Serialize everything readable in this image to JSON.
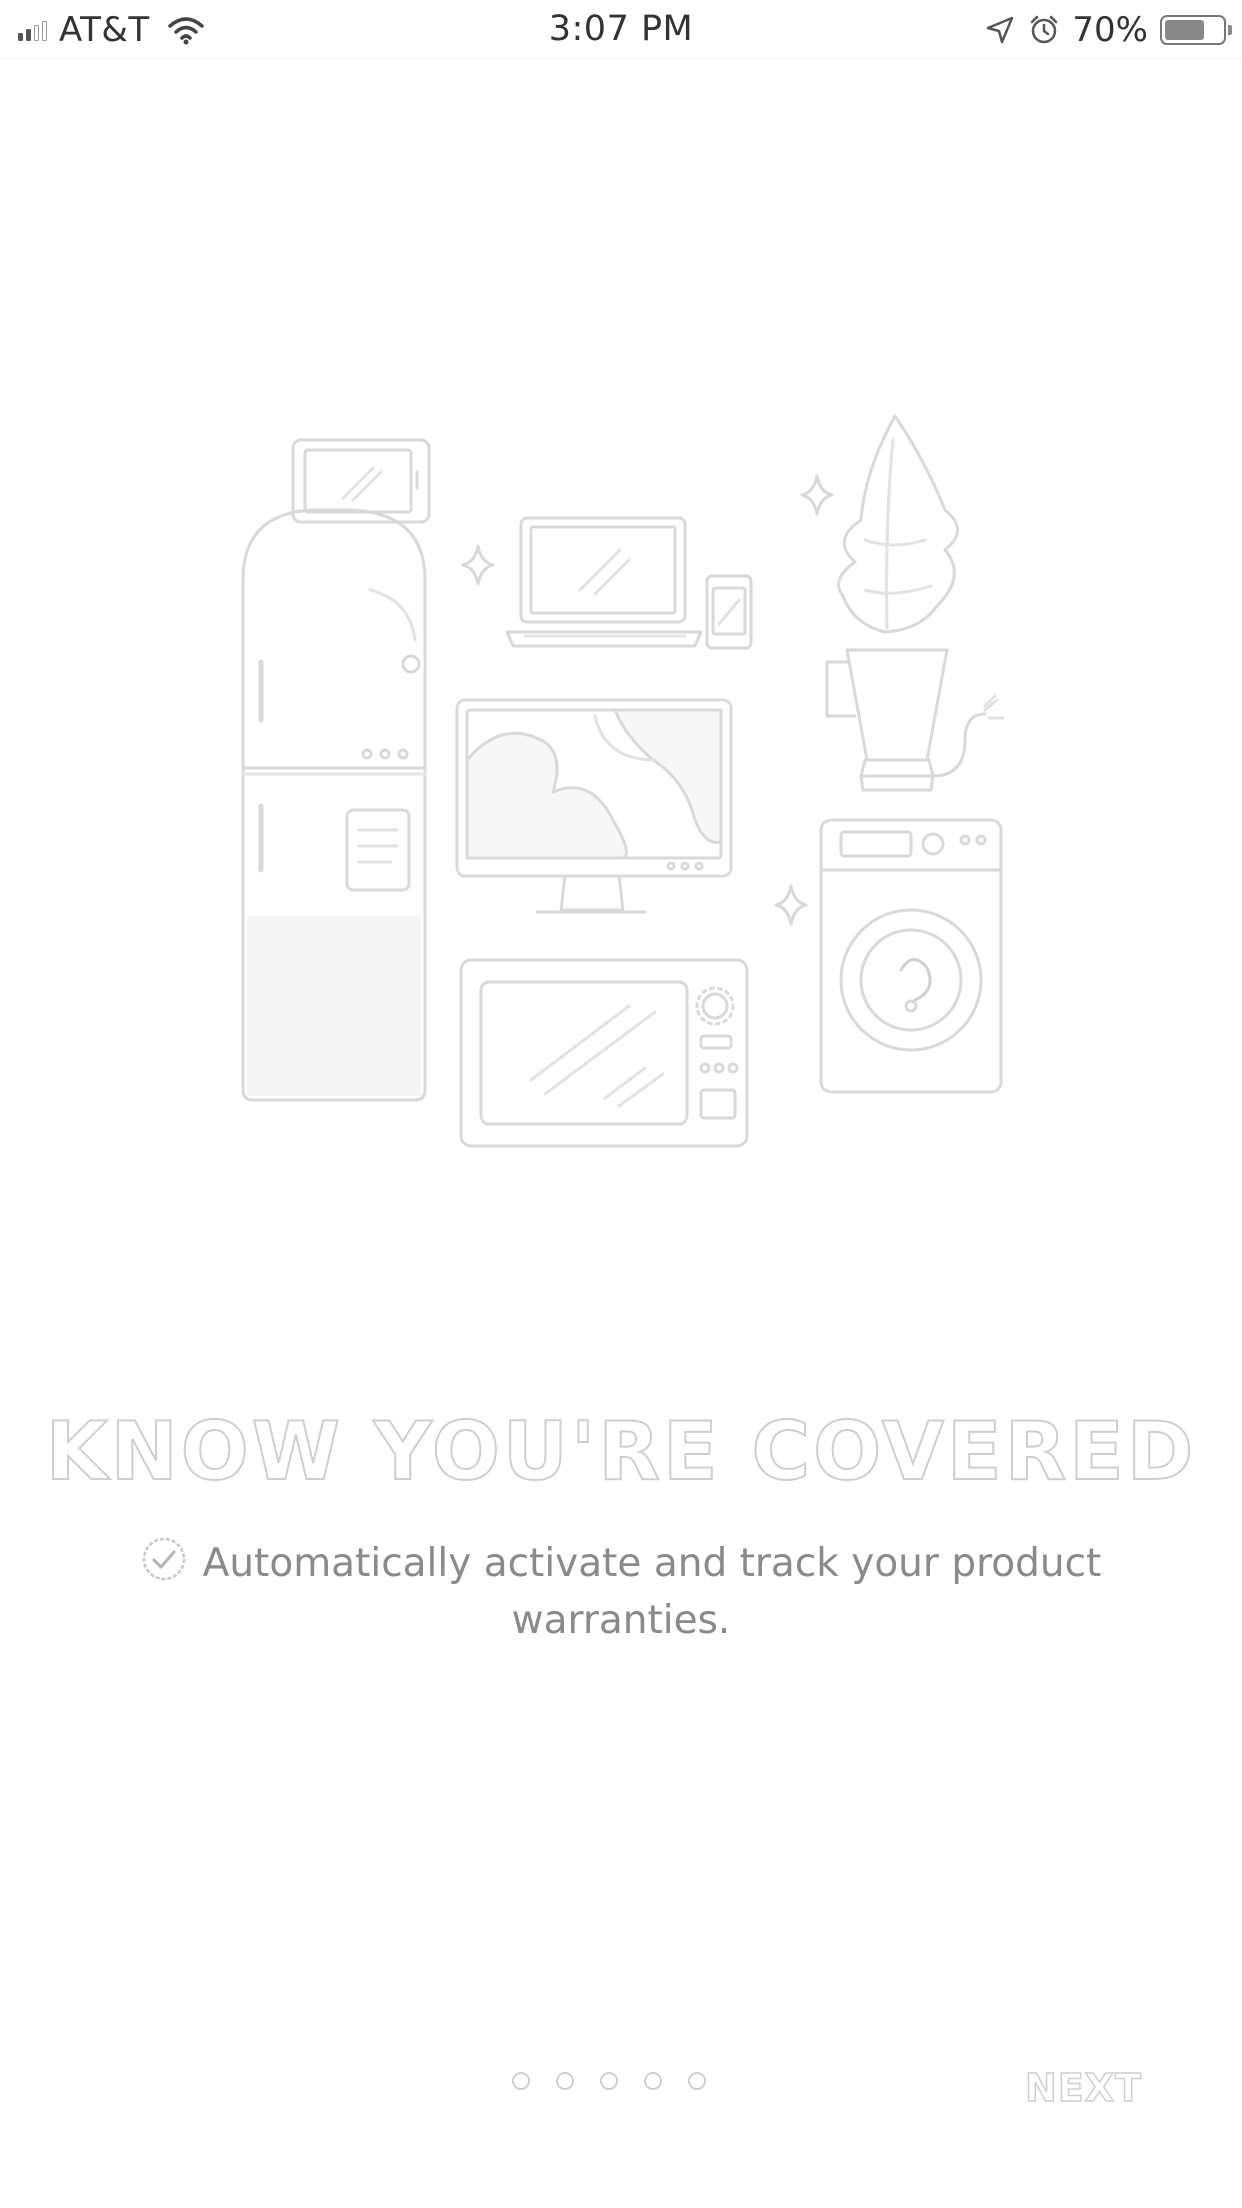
{
  "status_bar": {
    "carrier": "AT&T",
    "time": "3:07 PM",
    "battery_percent": "70%",
    "battery_level": 0.7,
    "signal_bars_filled": 2,
    "signal_bars_total": 4,
    "icons": [
      "signal-icon",
      "wifi-icon",
      "location-arrow-icon",
      "alarm-clock-icon",
      "battery-icon"
    ]
  },
  "illustration": {
    "name": "home-electronics-illustration",
    "items": [
      "tablet-icon",
      "laptop-icon",
      "phone-icon",
      "refrigerator-icon",
      "monitor-icon",
      "blender-icon",
      "washing-machine-icon",
      "microwave-icon"
    ]
  },
  "onboarding": {
    "headline": "KNOW YOU'RE COVERED",
    "feature_text": "Automatically activate and track your product warranties.",
    "feature_icon": "check-circle-icon"
  },
  "pager": {
    "page_count": 5,
    "current_page": 1
  },
  "navigation": {
    "next_label": "NEXT"
  },
  "colors": {
    "outline_gray": "#cfcfcf",
    "text_gray": "#8a8a8a",
    "background": "#ffffff"
  }
}
